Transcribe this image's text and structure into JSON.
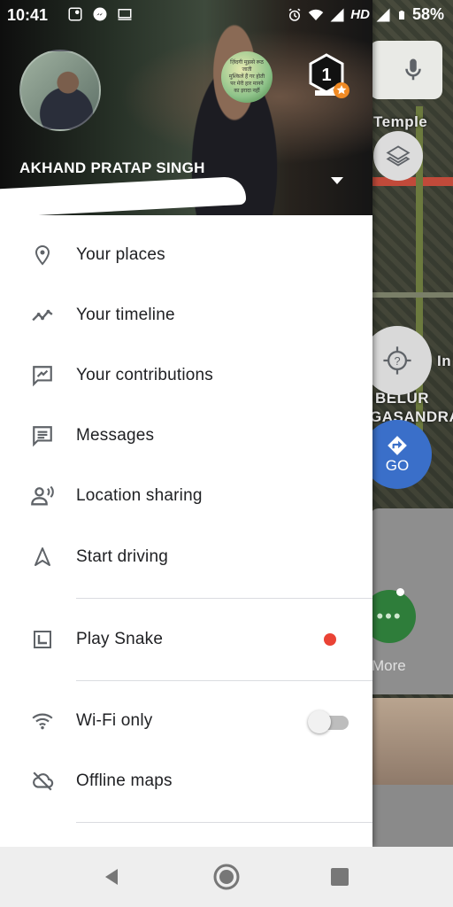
{
  "status_bar": {
    "time": "10:41",
    "network": "HD",
    "battery": "58%",
    "left_icons": [
      "maps-notification-icon",
      "messenger-icon",
      "cast-icon"
    ],
    "right_icons": [
      "alarm-icon",
      "wifi-icon",
      "signal-icon",
      "signal-icon-2",
      "battery-icon"
    ]
  },
  "drawer": {
    "account": {
      "name": "AKHAND PRATAP SINGH",
      "badge_text": [
        "ज़िंदगी मुझसे रूठ जाती",
        "मुश्किलें हैं गर होती",
        "पर मेरी हार मानने",
        "का इरादा नहीं"
      ]
    },
    "menu": [
      {
        "name": "your-places",
        "label": "Your places",
        "icon": "pin-icon"
      },
      {
        "name": "your-timeline",
        "label": "Your timeline",
        "icon": "timeline-icon"
      },
      {
        "name": "your-contributions",
        "label": "Your contributions",
        "icon": "contribute-icon"
      },
      {
        "name": "messages",
        "label": "Messages",
        "icon": "message-icon"
      },
      {
        "name": "location-sharing",
        "label": "Location sharing",
        "icon": "share-location-icon"
      },
      {
        "name": "start-driving",
        "label": "Start driving",
        "icon": "navigation-arrow-icon"
      },
      {
        "name": "play-snake",
        "label": "Play Snake",
        "icon": "snake-game-icon",
        "indicator": "red-dot"
      },
      {
        "name": "wifi-only",
        "label": "Wi-Fi only",
        "icon": "wifi-icon",
        "toggle": false
      },
      {
        "name": "offline-maps",
        "label": "Offline maps",
        "icon": "offline-cloud-icon"
      }
    ]
  },
  "map": {
    "labels": [
      "Temple",
      "BELUR",
      "GASANDRA",
      "In"
    ],
    "go_label": "GO",
    "more_label": "More"
  },
  "colors": {
    "accent_red": "#ea4335",
    "go_blue": "#3a6fc9",
    "more_green": "#2e7d3a",
    "text_primary": "#202124",
    "icon_gray": "#5f6368"
  },
  "nav_bar": {
    "buttons": [
      "back-icon",
      "home-icon",
      "recents-icon"
    ]
  }
}
